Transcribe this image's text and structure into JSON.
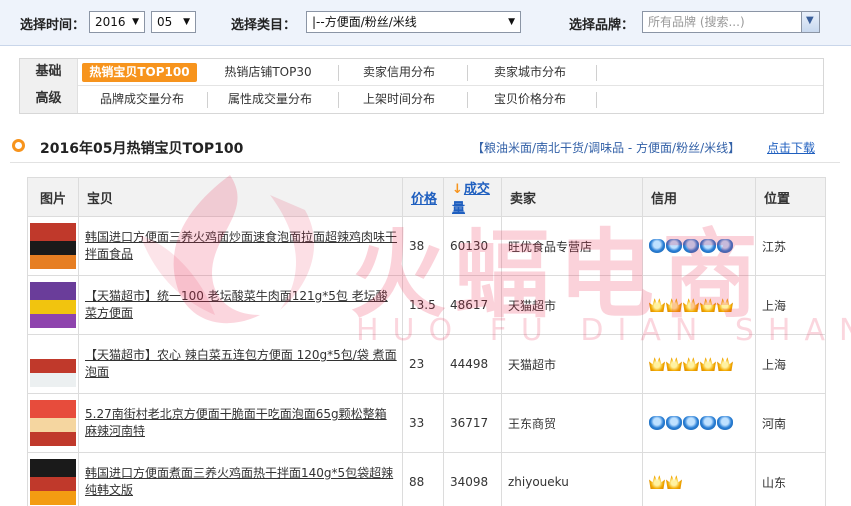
{
  "filters": {
    "time_label": "选择时间：",
    "year": "2016",
    "month": "05",
    "category_label": "选择类目：",
    "category": "|--方便面/粉丝/米线",
    "brand_label": "选择品牌：",
    "brand_placeholder": "所有品牌 (搜索...)"
  },
  "tabs": {
    "row1": {
      "head": "基础",
      "items": [
        "热销宝贝TOP100",
        "热销店铺TOP30",
        "卖家信用分布",
        "卖家城市分布"
      ],
      "active": 0
    },
    "row2": {
      "head": "高级",
      "items": [
        "品牌成交量分布",
        "属性成交量分布",
        "上架时间分布",
        "宝贝价格分布"
      ]
    }
  },
  "section": {
    "title": "2016年05月热销宝贝TOP100",
    "category_path": "【粮油米面/南北干货/调味品 - 方便面/粉丝/米线】",
    "download": "点击下载"
  },
  "table": {
    "headers": {
      "pic": "图片",
      "item": "宝贝",
      "price": "价格",
      "sales_arrow": "↓",
      "sales": "成交量",
      "seller": "卖家",
      "credit": "信用",
      "location": "位置"
    },
    "rows": [
      {
        "title": "韩国进口方便面三养火鸡面炒面速食泡面拉面超辣鸡肉味干拌面食品",
        "price": "38",
        "sales": "60130",
        "seller": "旺优食品专营店",
        "credit_icon": "blue-crown",
        "credit_count": 5,
        "location": "江苏",
        "thumb_colors": [
          "#c0392b",
          "#1a1a1a",
          "#e67e22"
        ]
      },
      {
        "title": "【天猫超市】统一100 老坛酸菜牛肉面121g*5包 老坛酸菜方便面",
        "price": "13.5",
        "sales": "48617",
        "seller": "天猫超市",
        "credit_icon": "gold-crown",
        "credit_count": 5,
        "location": "上海",
        "thumb_colors": [
          "#6a3d9a",
          "#f1c40f",
          "#8e44ad"
        ]
      },
      {
        "title": "【天猫超市】农心 辣白菜五连包方便面 120g*5包/袋 煮面 泡面",
        "price": "23",
        "sales": "44498",
        "seller": "天猫超市",
        "credit_icon": "gold-crown",
        "credit_count": 5,
        "location": "上海",
        "thumb_colors": [
          "#ffffff",
          "#c0392b",
          "#ecf0f1"
        ]
      },
      {
        "title": "5.27南街村老北京方便面干脆面干吃面泡面65g颗松整箱麻辣河南特",
        "price": "33",
        "sales": "36717",
        "seller": "王东商贸",
        "credit_icon": "blue-crown",
        "credit_count": 5,
        "location": "河南",
        "thumb_colors": [
          "#e74c3c",
          "#f5d6a0",
          "#c0392b"
        ]
      },
      {
        "title": "韩国进口方便面煮面三养火鸡面热干拌面140g*5包袋超辣纯韩文版",
        "price": "88",
        "sales": "34098",
        "seller": "zhiyoueku",
        "credit_icon": "gold-crown",
        "credit_count": 2,
        "location": "山东",
        "thumb_colors": [
          "#1a1a1a",
          "#c0392b",
          "#f39c12"
        ]
      }
    ]
  },
  "watermark": {
    "text": "火蝠电商",
    "sub": "HUO FU DIAN SHANG"
  }
}
